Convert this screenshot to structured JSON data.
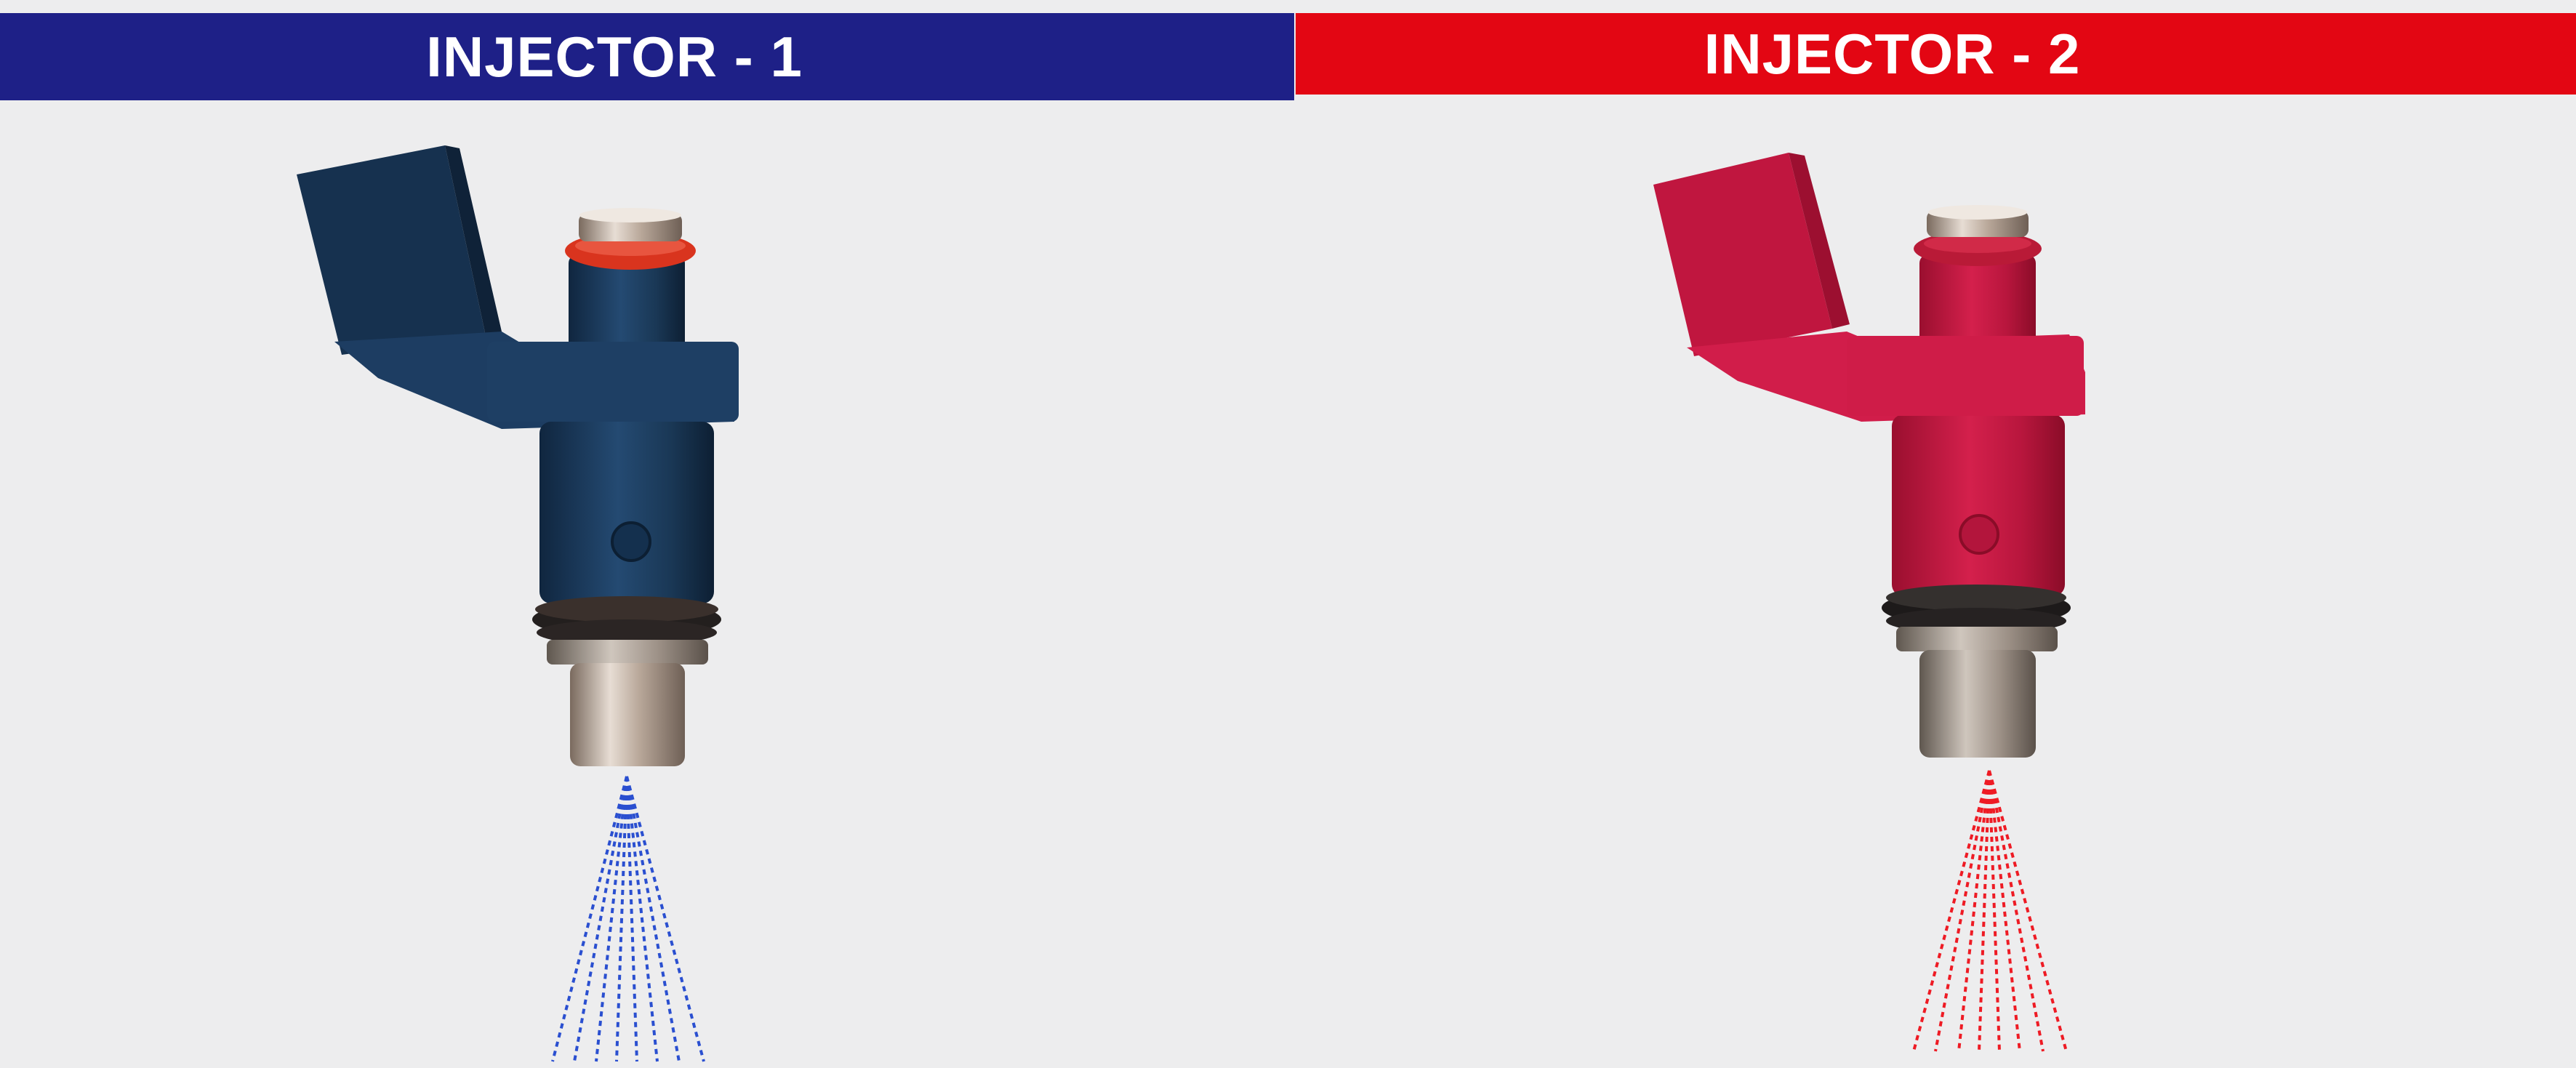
{
  "banners": {
    "left": {
      "title": "INJECTOR - 1",
      "color": "#1e2087"
    },
    "right": {
      "title": "INJECTOR - 2",
      "color": "#e30613"
    }
  },
  "injectors": [
    {
      "body_color": "#1c3a5e",
      "spray_color": "#2a4fd0"
    },
    {
      "body_color": "#c8173f",
      "spray_color": "#ee1b24"
    }
  ],
  "icons": [
    "fuel-injector-icon",
    "fuel-spray-icon"
  ]
}
